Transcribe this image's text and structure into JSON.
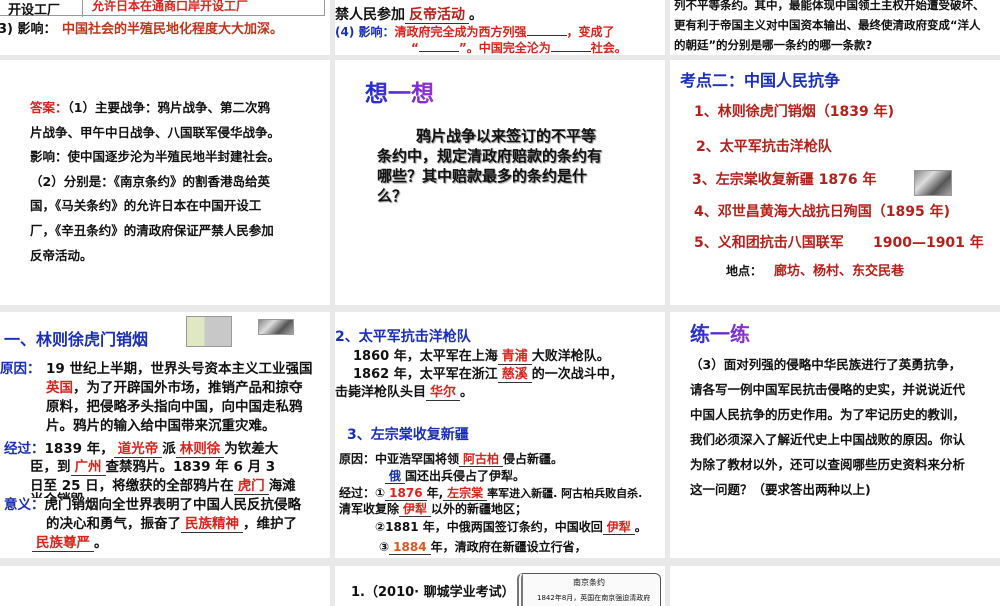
{
  "slides": {
    "top_left": {
      "table_left": "开设工厂",
      "table_right": "允许日本在通商口岸开设工厂",
      "impact_label": "(3) 影响：",
      "impact_text": "中国社会的半殖民地化程度大大加深。"
    },
    "top_mid": {
      "line1": "禁人民参加",
      "line1_ans": "反帝活动",
      "line1_end": "。",
      "impact_label": "(4) 影响：",
      "line2a": "清政府完全成为西方列强",
      "line2b": "，变成了",
      "line3a": "“",
      "line3b": "”。中国完全沦为",
      "line3c": "社会。"
    },
    "top_right": {
      "line1": "列不平等条约。其中，最能体现中国领土主权开始遭受破坏、",
      "line2": "更有利于帝国主义对中国资本输出、最终使清政府变成“洋人",
      "line3": "的朝廷”的分别是哪一条约的哪一条款?"
    },
    "answer": {
      "label": "答案：",
      "lines": [
        "（1）主要战争：鸦片战争、第二次鸦",
        "片战争、甲午中日战争、八国联军侵华战争。",
        "影响：使中国逐步沦为半殖民地半封建社会。",
        "（2）分别是：《南京条约》的割香港岛给英",
        "国，《马关条约》的允许日本在中国开设工",
        "厂，《辛丑条约》的清政府保证严禁人民参加",
        "反帝活动。"
      ]
    },
    "think": {
      "title": "想一想",
      "text": "鸦片战争以来签订的不平等条约中，规定清政府赔款的条约有哪些？其中赔款最多的条约是什么？"
    },
    "kaodian": {
      "title": "考点二：中国人民抗争",
      "items": [
        "1、林则徐虎门销烟（1839 年)",
        "2、太平军抗击洋枪队",
        "3、左宗棠收复新疆 1876 年",
        "4、邓世昌黄海大战抗日殉国（1895 年)",
        "5、义和团抗击八国联军      1900—1901 年"
      ],
      "place_label": "地点：",
      "place": "廊坊、杨村、东交民巷"
    },
    "linzexu": {
      "title": "一、林则徐虎门销烟",
      "cause_label": "原因：",
      "cause": [
        "19 世纪上半期，世界头号资本主义工业强国",
        "为了开辟国外市场，推销产品和掠夺",
        "原料，把侵略矛头指向中国，向中国走私鸦",
        "片。鸦片的输入给中国带来沉重灾难。"
      ],
      "cause_ans": "英国",
      "process_label": "经过：",
      "p1a": "1839 年，",
      "p1_ans1": "道光帝",
      "p1b": "派",
      "p1_ans2": "林则徐",
      "p1c": "为钦差大",
      "p2a": "臣，到",
      "p2_ans": "广州",
      "p2b": "查禁鸦片。1839 年 6 月 3",
      "p3a": "日至 25 日，将缴获的全部鸦片在",
      "p3_ans": "虎门",
      "p3b": "海滩",
      "p4": "当众销毁。",
      "meaning_label": "意义：",
      "m1": "虎门销烟向全世界表明了中国人民反抗侵略",
      "m2a": "的决心和勇气，振奋了",
      "m2_ans": "民族精神",
      "m2b": "，维护了",
      "m3_ans": "民族尊严",
      "m3b": "。"
    },
    "taiping": {
      "title": "2、太平军抗击洋枪队",
      "l1a": "1860 年，太平军在上海",
      "l1_ans": "青浦",
      "l1b": "大败洋枪队。",
      "l2a": "1862 年，太平军在浙江",
      "l2_ans": "慈溪",
      "l2b": "的一次战斗中，",
      "l3a": "击毙洋枪队头目",
      "l3_ans": "华尔",
      "l3b": "。",
      "title2": "3、左宗棠收复新疆",
      "c1a": "原因：中亚浩罕国将领",
      "c1_ans": "阿古柏",
      "c1b": "侵占新疆。",
      "c2_ans": "俄",
      "c2b": "国还出兵侵占了伊犁。",
      "d1a": "经过：①",
      "d1_ans1": "1876",
      "d1b": "年,",
      "d1_ans2": "左宗棠",
      "d1c": "率军进入新疆. 阿古柏兵败自杀.",
      "d2a": "清军收复除",
      "d2_ans": "伊犁",
      "d2b": "以外的新疆地区；",
      "d3a": "②1881 年，中俄两国签订条约，中国收回",
      "d3_ans": "伊犁",
      "d3b": "。",
      "d4a": "③",
      "d4_ans": "1884",
      "d4b": "年，清政府在新疆设立行省，"
    },
    "practice": {
      "title": "练一练",
      "lines": [
        "（3）面对列强的侵略中华民族进行了英勇抗争，",
        "请各写一例中国军民抗击侵略的史实，并说说近代",
        "中国人民抗争的历史作用。为了牢记历史的教训，",
        "我们必须深入了解近代史上中国战败的原因。你认",
        "为除了教材以外，还可以查阅哪些历史资料来分析",
        "这一问题？（要求答出两种以上)"
      ]
    },
    "exam": {
      "title": "1.（2010· 聊城学业考试）",
      "scroll_title": "南京条约",
      "scroll_line": "1842年8月，英国在南京强迫清政府"
    }
  }
}
